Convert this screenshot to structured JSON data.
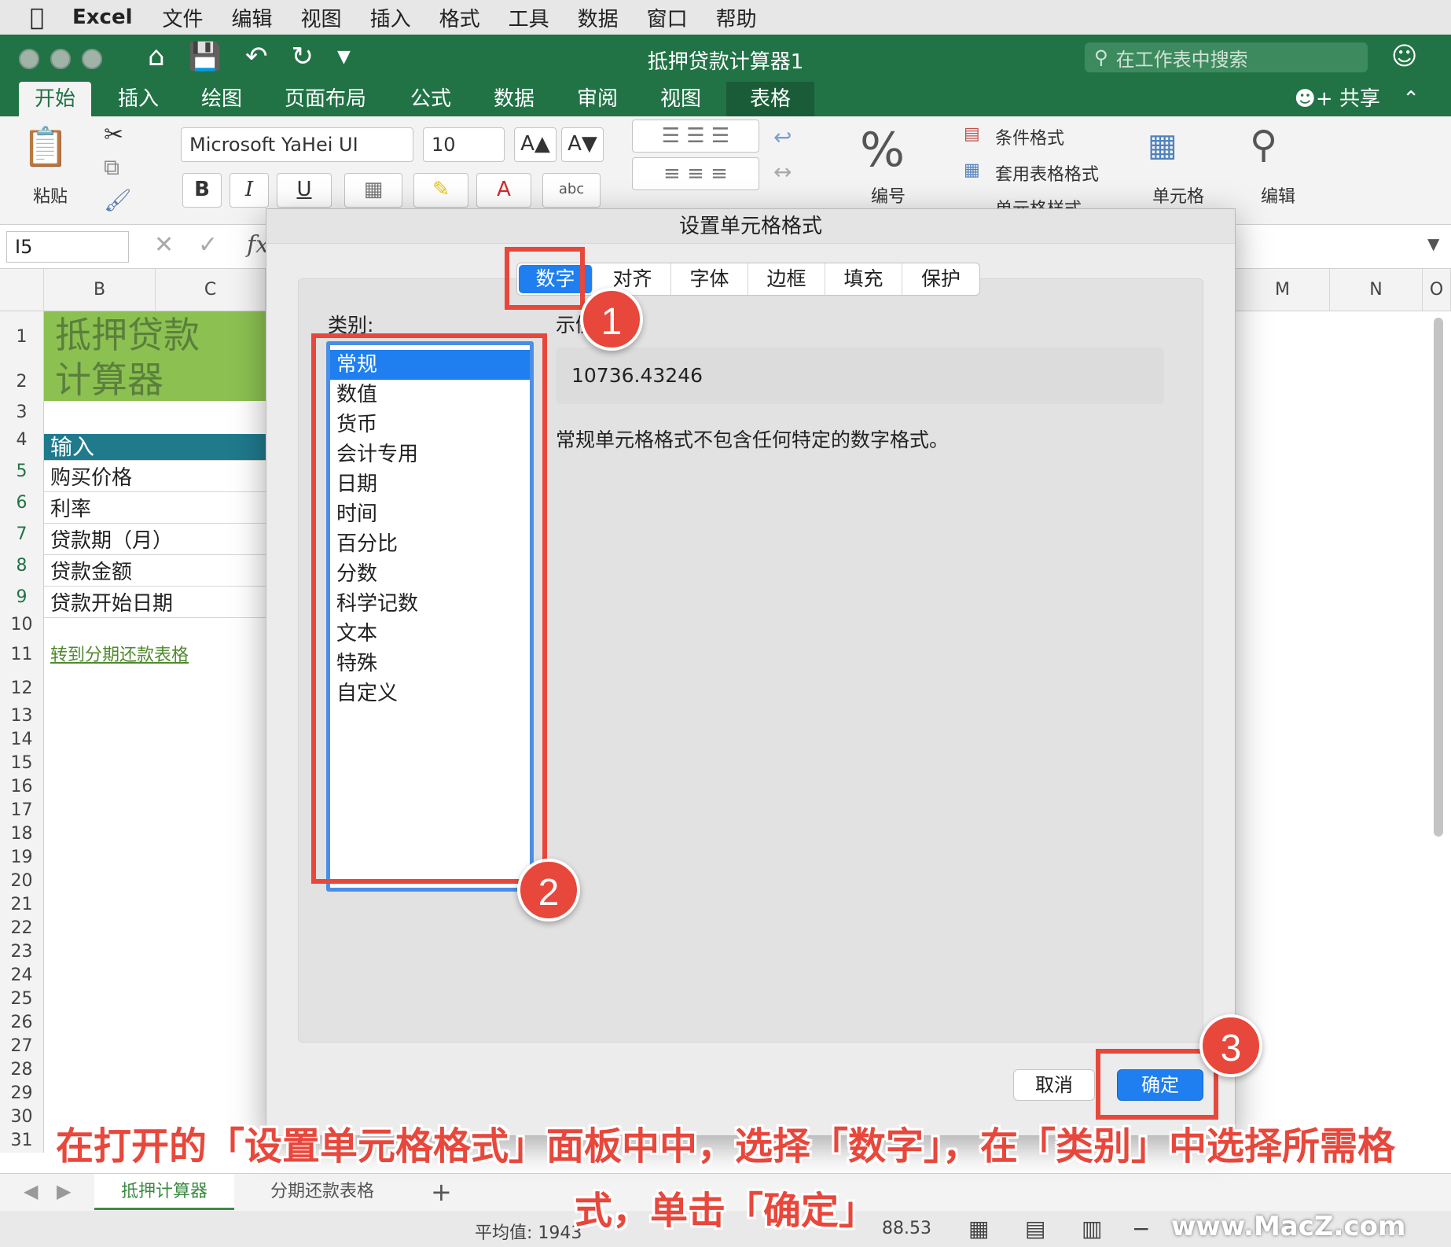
{
  "menubar": {
    "app": "Excel",
    "items": [
      "文件",
      "编辑",
      "视图",
      "插入",
      "格式",
      "工具",
      "数据",
      "窗口",
      "帮助"
    ]
  },
  "titlebar": {
    "title": "抵押贷款计算器1",
    "search_placeholder": "在工作表中搜索"
  },
  "ribbon_tabs": [
    "开始",
    "插入",
    "绘图",
    "页面布局",
    "公式",
    "数据",
    "审阅",
    "视图",
    "表格"
  ],
  "share_label": "共享",
  "ribbon": {
    "paste_label": "粘贴",
    "font_name": "Microsoft YaHei UI",
    "font_size": "10",
    "number_label": "编号",
    "cond_format": "条件格式",
    "table_format": "套用表格格式",
    "cell_style": "单元格样式",
    "cells_label": "单元格",
    "edit_label": "编辑"
  },
  "formula_bar": {
    "name_box": "I5",
    "fx": "fx"
  },
  "columns": [
    "B",
    "C",
    "M",
    "N",
    "O"
  ],
  "rows": [
    "1",
    "2",
    "3",
    "4",
    "5",
    "6",
    "7",
    "8",
    "9",
    "10",
    "11",
    "12",
    "13",
    "14",
    "15",
    "16",
    "17",
    "18",
    "19",
    "20",
    "21",
    "22",
    "23",
    "24",
    "25",
    "26",
    "27",
    "28",
    "29",
    "30",
    "31"
  ],
  "sheet_cells": {
    "title_line1": "抵押贷款",
    "title_line2": "计算器",
    "input_header": "输入",
    "purchase_price": "购买价格",
    "rate": "利率",
    "term": "贷款期（月）",
    "amount": "贷款金额",
    "start_date": "贷款开始日期",
    "link": "转到分期还款表格"
  },
  "sheet_tabs": [
    "抵押计算器",
    "分期还款表格"
  ],
  "status": {
    "average": "平均值: 1943",
    "sum_tail": "88.53"
  },
  "dialog": {
    "title": "设置单元格格式",
    "tabs": [
      "数字",
      "对齐",
      "字体",
      "边框",
      "填充",
      "保护"
    ],
    "category_label": "类别:",
    "sample_label": "示例",
    "categories": [
      "常规",
      "数值",
      "货币",
      "会计专用",
      "日期",
      "时间",
      "百分比",
      "分数",
      "科学记数",
      "文本",
      "特殊",
      "自定义"
    ],
    "sample_value": "10736.43246",
    "description": "常规单元格格式不包含任何特定的数字格式。",
    "cancel": "取消",
    "ok": "确定"
  },
  "annotations": {
    "badges": [
      "1",
      "2",
      "3"
    ],
    "caption_line1": "在打开的「设置单元格格式」面板中中，选择「数字」，在「类别」中选择所需格",
    "caption_line2": "式，单击「确定」",
    "watermark": "www.MacZ.com",
    "color": "#e8473c"
  }
}
